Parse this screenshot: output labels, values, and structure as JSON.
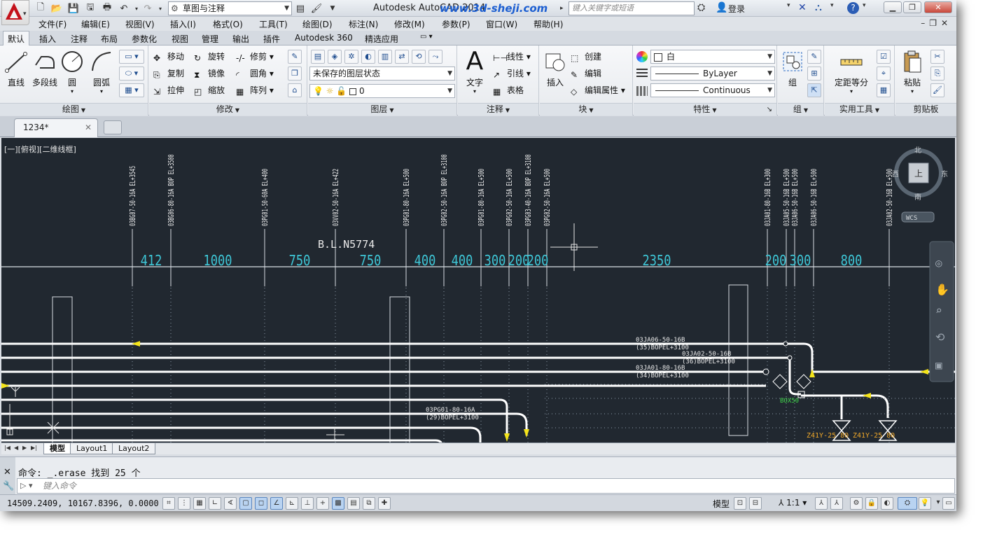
{
  "titlebar": {
    "workspace": "草图与注释",
    "title": "Autodesk AutoCAD 2014",
    "watermark": "www.3d-sheji.com",
    "search_placeholder": "键入关键字或短语",
    "login": "登录"
  },
  "menubar": {
    "items": [
      "文件(F)",
      "编辑(E)",
      "视图(V)",
      "插入(I)",
      "格式(O)",
      "工具(T)",
      "绘图(D)",
      "标注(N)",
      "修改(M)",
      "参数(P)",
      "窗口(W)",
      "帮助(H)"
    ]
  },
  "ribbon_tabs": [
    "默认",
    "插入",
    "注释",
    "布局",
    "参数化",
    "视图",
    "管理",
    "输出",
    "插件",
    "Autodesk 360",
    "精选应用"
  ],
  "ribbon": {
    "draw": {
      "title": "绘图",
      "line": "直线",
      "polyline": "多段线",
      "circle": "圆",
      "arc": "圆弧"
    },
    "modify": {
      "title": "修改",
      "move": "移动",
      "rotate": "旋转",
      "trim": "修剪",
      "copy": "复制",
      "mirror": "镜像",
      "fillet": "圆角",
      "stretch": "拉伸",
      "scale": "缩放",
      "array": "阵列"
    },
    "layers": {
      "title": "图层",
      "state": "未保存的图层状态",
      "current": "0"
    },
    "annotation": {
      "title": "注释",
      "text": "文字",
      "linear": "线性",
      "leader": "引线",
      "table": "表格"
    },
    "block": {
      "title": "块",
      "insert": "插入",
      "create": "创建",
      "edit": "编辑",
      "edit_attr": "编辑属性"
    },
    "properties": {
      "title": "特性",
      "color": "白",
      "lineweight": "ByLayer",
      "linetype": "Continuous"
    },
    "groups": {
      "title": "组",
      "group": "组"
    },
    "utilities": {
      "title": "实用工具",
      "measure": "定距等分"
    },
    "clipboard": {
      "title": "剪贴板",
      "paste": "粘贴"
    }
  },
  "doc_tab": "1234*",
  "viewport_label": "[一][俯视][二维线框]",
  "viewcube": {
    "north": "北",
    "south": "南",
    "east": "东",
    "west": "西",
    "top": "上",
    "wcs": "WCS"
  },
  "drawing": {
    "dims": [
      "412",
      "1000",
      "750",
      "750",
      "400",
      "400",
      "300",
      "200",
      "200",
      "2350",
      "200",
      "300",
      "800"
    ],
    "baseline_label": "B.L.N5774",
    "pipe_labels": [
      "03BG07-50-16A EL+3545",
      "03BG06-80-16A BOP EL+3500",
      "03PG01-50-60A EL+400",
      "03VV02-50-16A EL+422",
      "03PG01-80-16A EL+500",
      "03PG02-50-16A BOP EL+3100",
      "03PG01-80-16A EL+500",
      "03PG02-50-16A EL+500",
      "03PG03-40-16A BOP EL+3100",
      "03PG02-50-16A EL+500",
      "03JA01-80-16B EL+300",
      "03JA05-50-16B EL+500",
      "03JA06-50-16B EL+500",
      "03JA06-50-16B EL+500",
      "03JA02-50-16B EL+500"
    ],
    "notes": [
      {
        "line1": "03JA06-50-16B",
        "line2": "(35)BOPEL+3100"
      },
      {
        "line1": "03JA02-50-16B",
        "line2": "(36)BOPEL+3100"
      },
      {
        "line1": "03JA01-80-16B",
        "line2": "(34)BOPEL+3100"
      },
      {
        "line1": "03PG01-80-16A",
        "line2": "(29)BOPEL+3100"
      }
    ],
    "box_label": "BOX50",
    "valve_labels": [
      "Z41Y-25 80",
      "Z41Y-25 80"
    ]
  },
  "layout_tabs": [
    "模型",
    "Layout1",
    "Layout2"
  ],
  "command": {
    "history": "命令:  _.erase 找到 25 个",
    "placeholder": "键入命令"
  },
  "status": {
    "coords": "14509.2409, 10167.8396, 0.0000",
    "model": "模型",
    "scale": "1:1"
  },
  "colors": {
    "canvas": "#212830",
    "dim_text": "#3ec6d6",
    "pipe": "#ffffff",
    "arrow": "#f4e41a",
    "box": "#3fd64a",
    "valve_label": "#f0a82a"
  }
}
